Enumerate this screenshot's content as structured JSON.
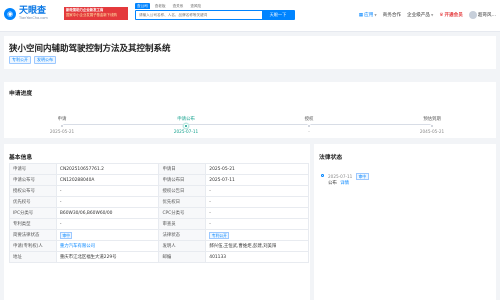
{
  "header": {
    "logo_text": "天眼查",
    "logo_subtext": "TianYanCha.com",
    "banner_line1": "新政策助力企业新发工商",
    "banner_line2": "国家中小企业发展子基金新下线购",
    "search_tabs": [
      "查公司",
      "查老板",
      "查关系",
      "查风险"
    ],
    "search_placeholder": "请输入公司名称、人名、品牌名称等关键词",
    "search_button": "天眼一下",
    "nav": {
      "apps": "应用",
      "business": "商务合作",
      "enterprise": "企业级产品",
      "vip": "开通会员",
      "user": "超哥风..."
    }
  },
  "patent": {
    "title": "狭小空间内辅助驾驶控制方法及其控制系统",
    "tags": [
      "专利公开",
      "发明公布"
    ]
  },
  "progress": {
    "title": "申请进度",
    "steps": [
      {
        "label": "申请",
        "date": "2025-05-21",
        "current": false
      },
      {
        "label": "申请公布",
        "date": "2025-07-11",
        "current": true
      },
      {
        "label": "授权",
        "date": "-",
        "current": false
      },
      {
        "label": "预估到期",
        "date": "2045-05-21",
        "current": false
      }
    ]
  },
  "basic_info": {
    "title": "基本信息",
    "rows": [
      {
        "k1": "申请号",
        "v1": "CN202510657761.2",
        "k2": "申请日",
        "v2": "2025-05-21"
      },
      {
        "k1": "申请公布号",
        "v1": "CN120288040A",
        "k2": "申请公布日",
        "v2": "2025-07-11"
      },
      {
        "k1": "授权公布号",
        "v1": "-",
        "k2": "授权公告日",
        "v2": "-"
      },
      {
        "k1": "优先权号",
        "v1": "-",
        "k2": "优先权日",
        "v2": "-"
      },
      {
        "k1": "IPC分类号",
        "v1": "B60W30/06,B60W60/00",
        "k2": "CPC分类号",
        "v2": "-"
      },
      {
        "k1": "专利类型",
        "v1": "-",
        "k2": "审查员",
        "v2": "-"
      },
      {
        "k1": "简要法律状态",
        "v1": "审中",
        "k2": "法律状态",
        "v2": "专利公开"
      },
      {
        "k1": "申请(专利权)人",
        "v1": "重力汽车有限公司",
        "k2": "发明人",
        "v2": "郝兴伍,王恒武,曹维炬,彭建,刘美阳"
      },
      {
        "k1": "地址",
        "v1": "重庆市江北区福生大道229号",
        "k2": "邮编",
        "v2": "401133"
      }
    ]
  },
  "legal_status": {
    "title": "法律状态",
    "date": "2025-07-11",
    "status": "审中",
    "event": "公布",
    "detail_link": "详情"
  },
  "colors": {
    "brand": "#0084ff",
    "current_step": "#0f9f8b",
    "vip": "#e4393c"
  }
}
